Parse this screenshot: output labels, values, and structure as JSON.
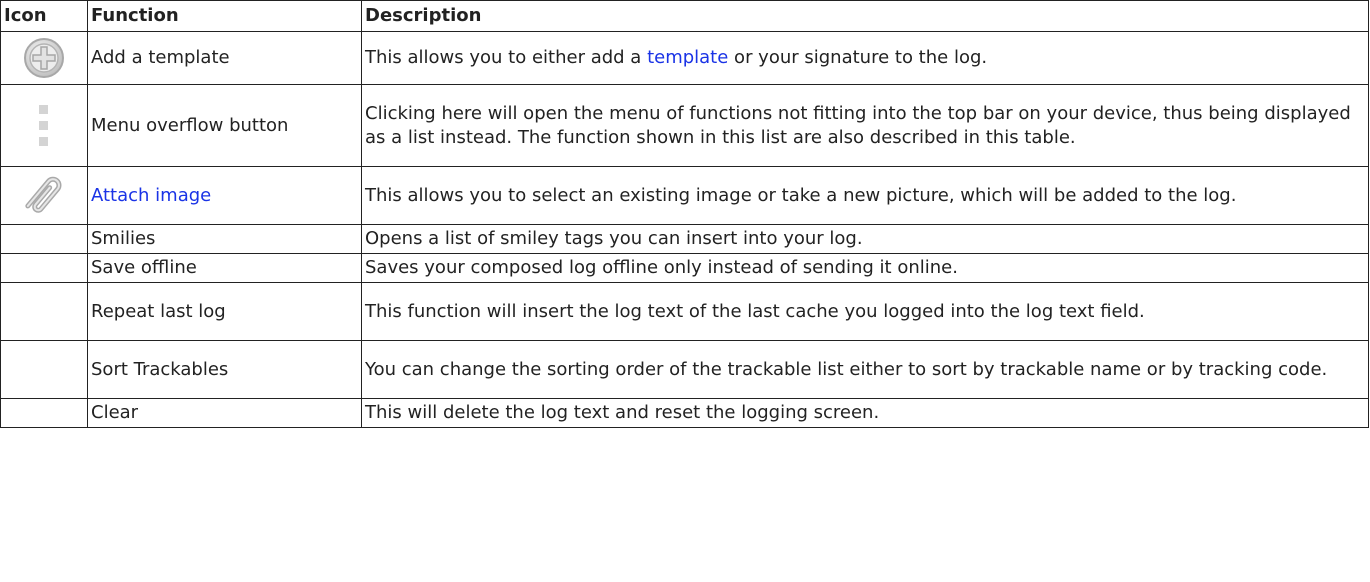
{
  "headers": {
    "icon": "Icon",
    "function": "Function",
    "description": "Description"
  },
  "rows": [
    {
      "icon": "add-circle-icon",
      "function": "Add a template",
      "desc_before": "This allows you to either add a ",
      "desc_link": "template",
      "desc_after": " or your signature to the log."
    },
    {
      "icon": "overflow-menu-icon",
      "function": "Menu overflow button",
      "description": "Clicking here will open the menu of functions not fitting into the top bar on your device, thus being displayed as a list instead. The function shown in this list are also described in this table."
    },
    {
      "icon": "paperclip-icon",
      "function": "Attach image",
      "description": "This allows you to select an existing image or take a new picture, which will be added to the log."
    },
    {
      "function": "Smilies",
      "description": "Opens a list of smiley tags you can insert into your log."
    },
    {
      "function": "Save offline",
      "description": "Saves your composed log offline only instead of sending it online."
    },
    {
      "function": "Repeat last log",
      "description": "This function will insert the log text of the last cache you logged into the log text field."
    },
    {
      "function": "Sort Trackables",
      "description": "You can change the sorting order of the trackable list either to sort by trackable name or by tracking code."
    },
    {
      "function": "Clear",
      "description": "This will delete the log text and reset the logging screen."
    }
  ],
  "colors": {
    "link": "#1a33e6",
    "border": "#222222",
    "icon_gray": "#c8c8c8"
  }
}
